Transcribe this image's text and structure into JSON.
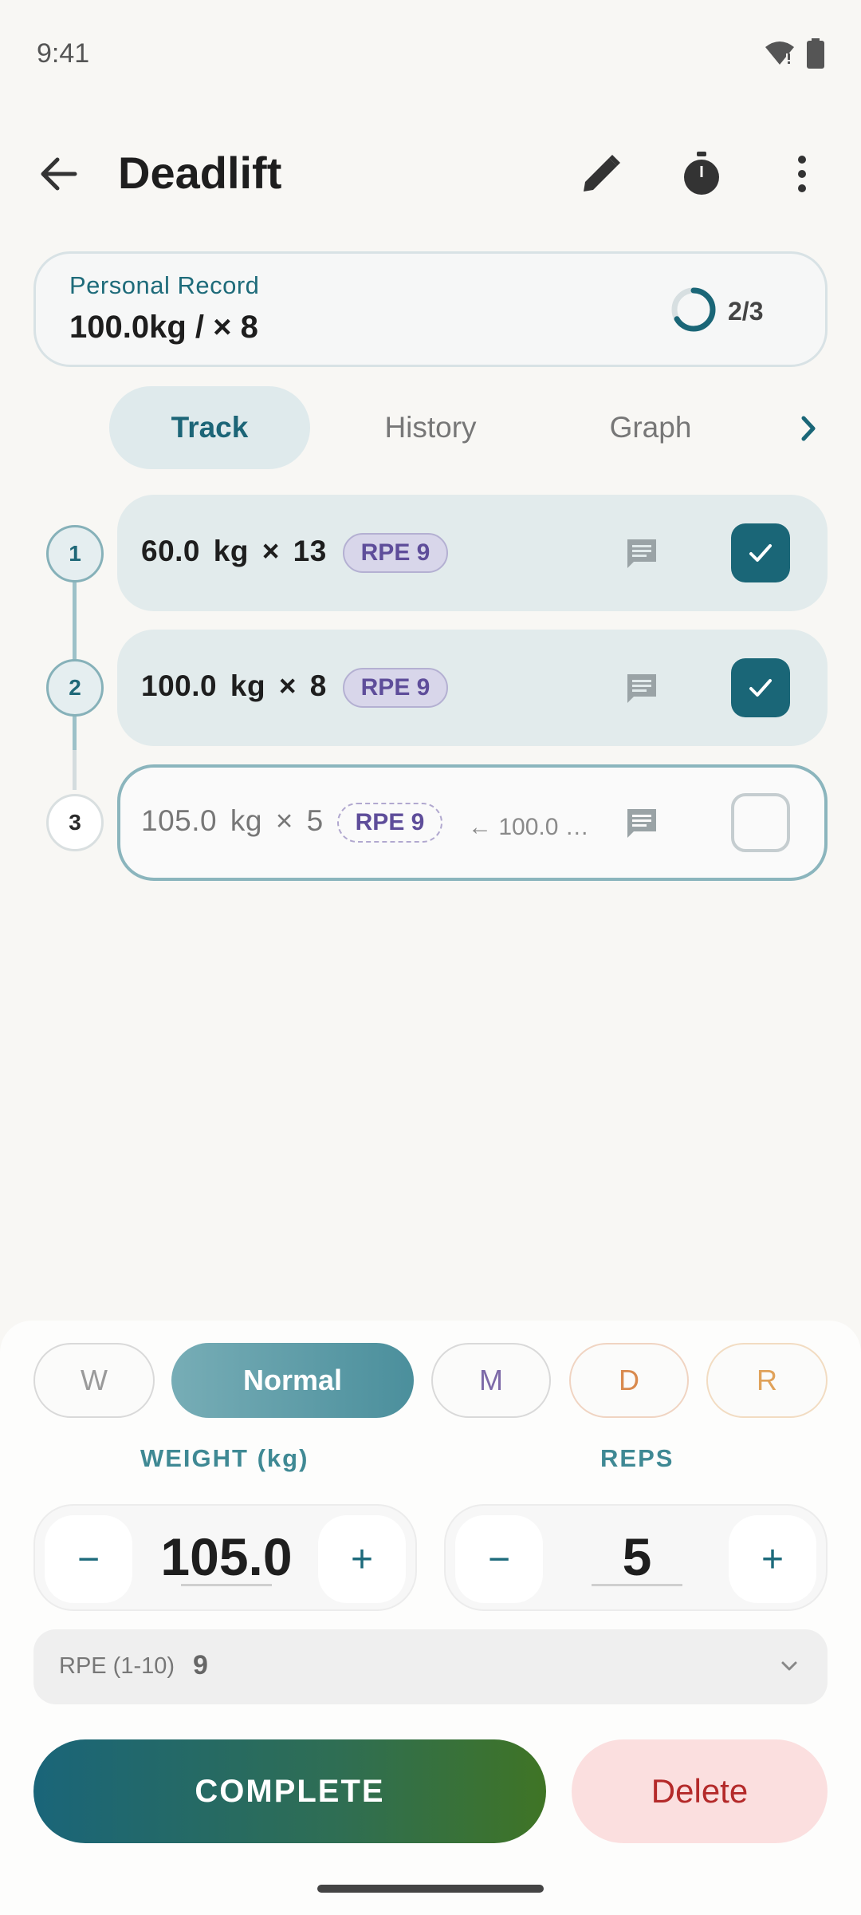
{
  "status_bar": {
    "time": "9:41"
  },
  "header": {
    "title": "Deadlift"
  },
  "personal_record": {
    "label": "Personal Record",
    "value": "100.0kg / × 8",
    "progress_text": "2/3",
    "progress_fraction": 0.667
  },
  "tabs": [
    {
      "label": "Track",
      "active": true
    },
    {
      "label": "History",
      "active": false
    },
    {
      "label": "Graph",
      "active": false
    }
  ],
  "sets": [
    {
      "number": "1",
      "text": "60.0  kg ×  13",
      "rpe": "RPE 9",
      "completed": true
    },
    {
      "number": "2",
      "text": "100.0  kg ×  8",
      "rpe": "RPE 9",
      "completed": true
    },
    {
      "number": "3",
      "text": "105.0  kg ×  5",
      "rpe": "RPE 9",
      "previous": "← 100.0 …",
      "completed": false
    }
  ],
  "set_types": [
    {
      "label": "W",
      "color": "#9a9a9a"
    },
    {
      "label": "Normal",
      "color": "#ffffff"
    },
    {
      "label": "M",
      "color": "#7d6aa8"
    },
    {
      "label": "D",
      "color": "#d98a4e"
    },
    {
      "label": "R",
      "color": "#e0a25a"
    }
  ],
  "inputs": {
    "weight_label": "WEIGHT (kg)",
    "weight_value": "105.0",
    "reps_label": "REPS",
    "reps_value": "5",
    "minus": "−",
    "plus": "+",
    "rpe_label": "RPE (1-10)",
    "rpe_value": "9"
  },
  "actions": {
    "complete": "COMPLETE",
    "delete": "Delete"
  },
  "colors": {
    "accent": "#1a6677",
    "rpe_chip": "#5e4d9a",
    "delete": "#b42a2a"
  }
}
